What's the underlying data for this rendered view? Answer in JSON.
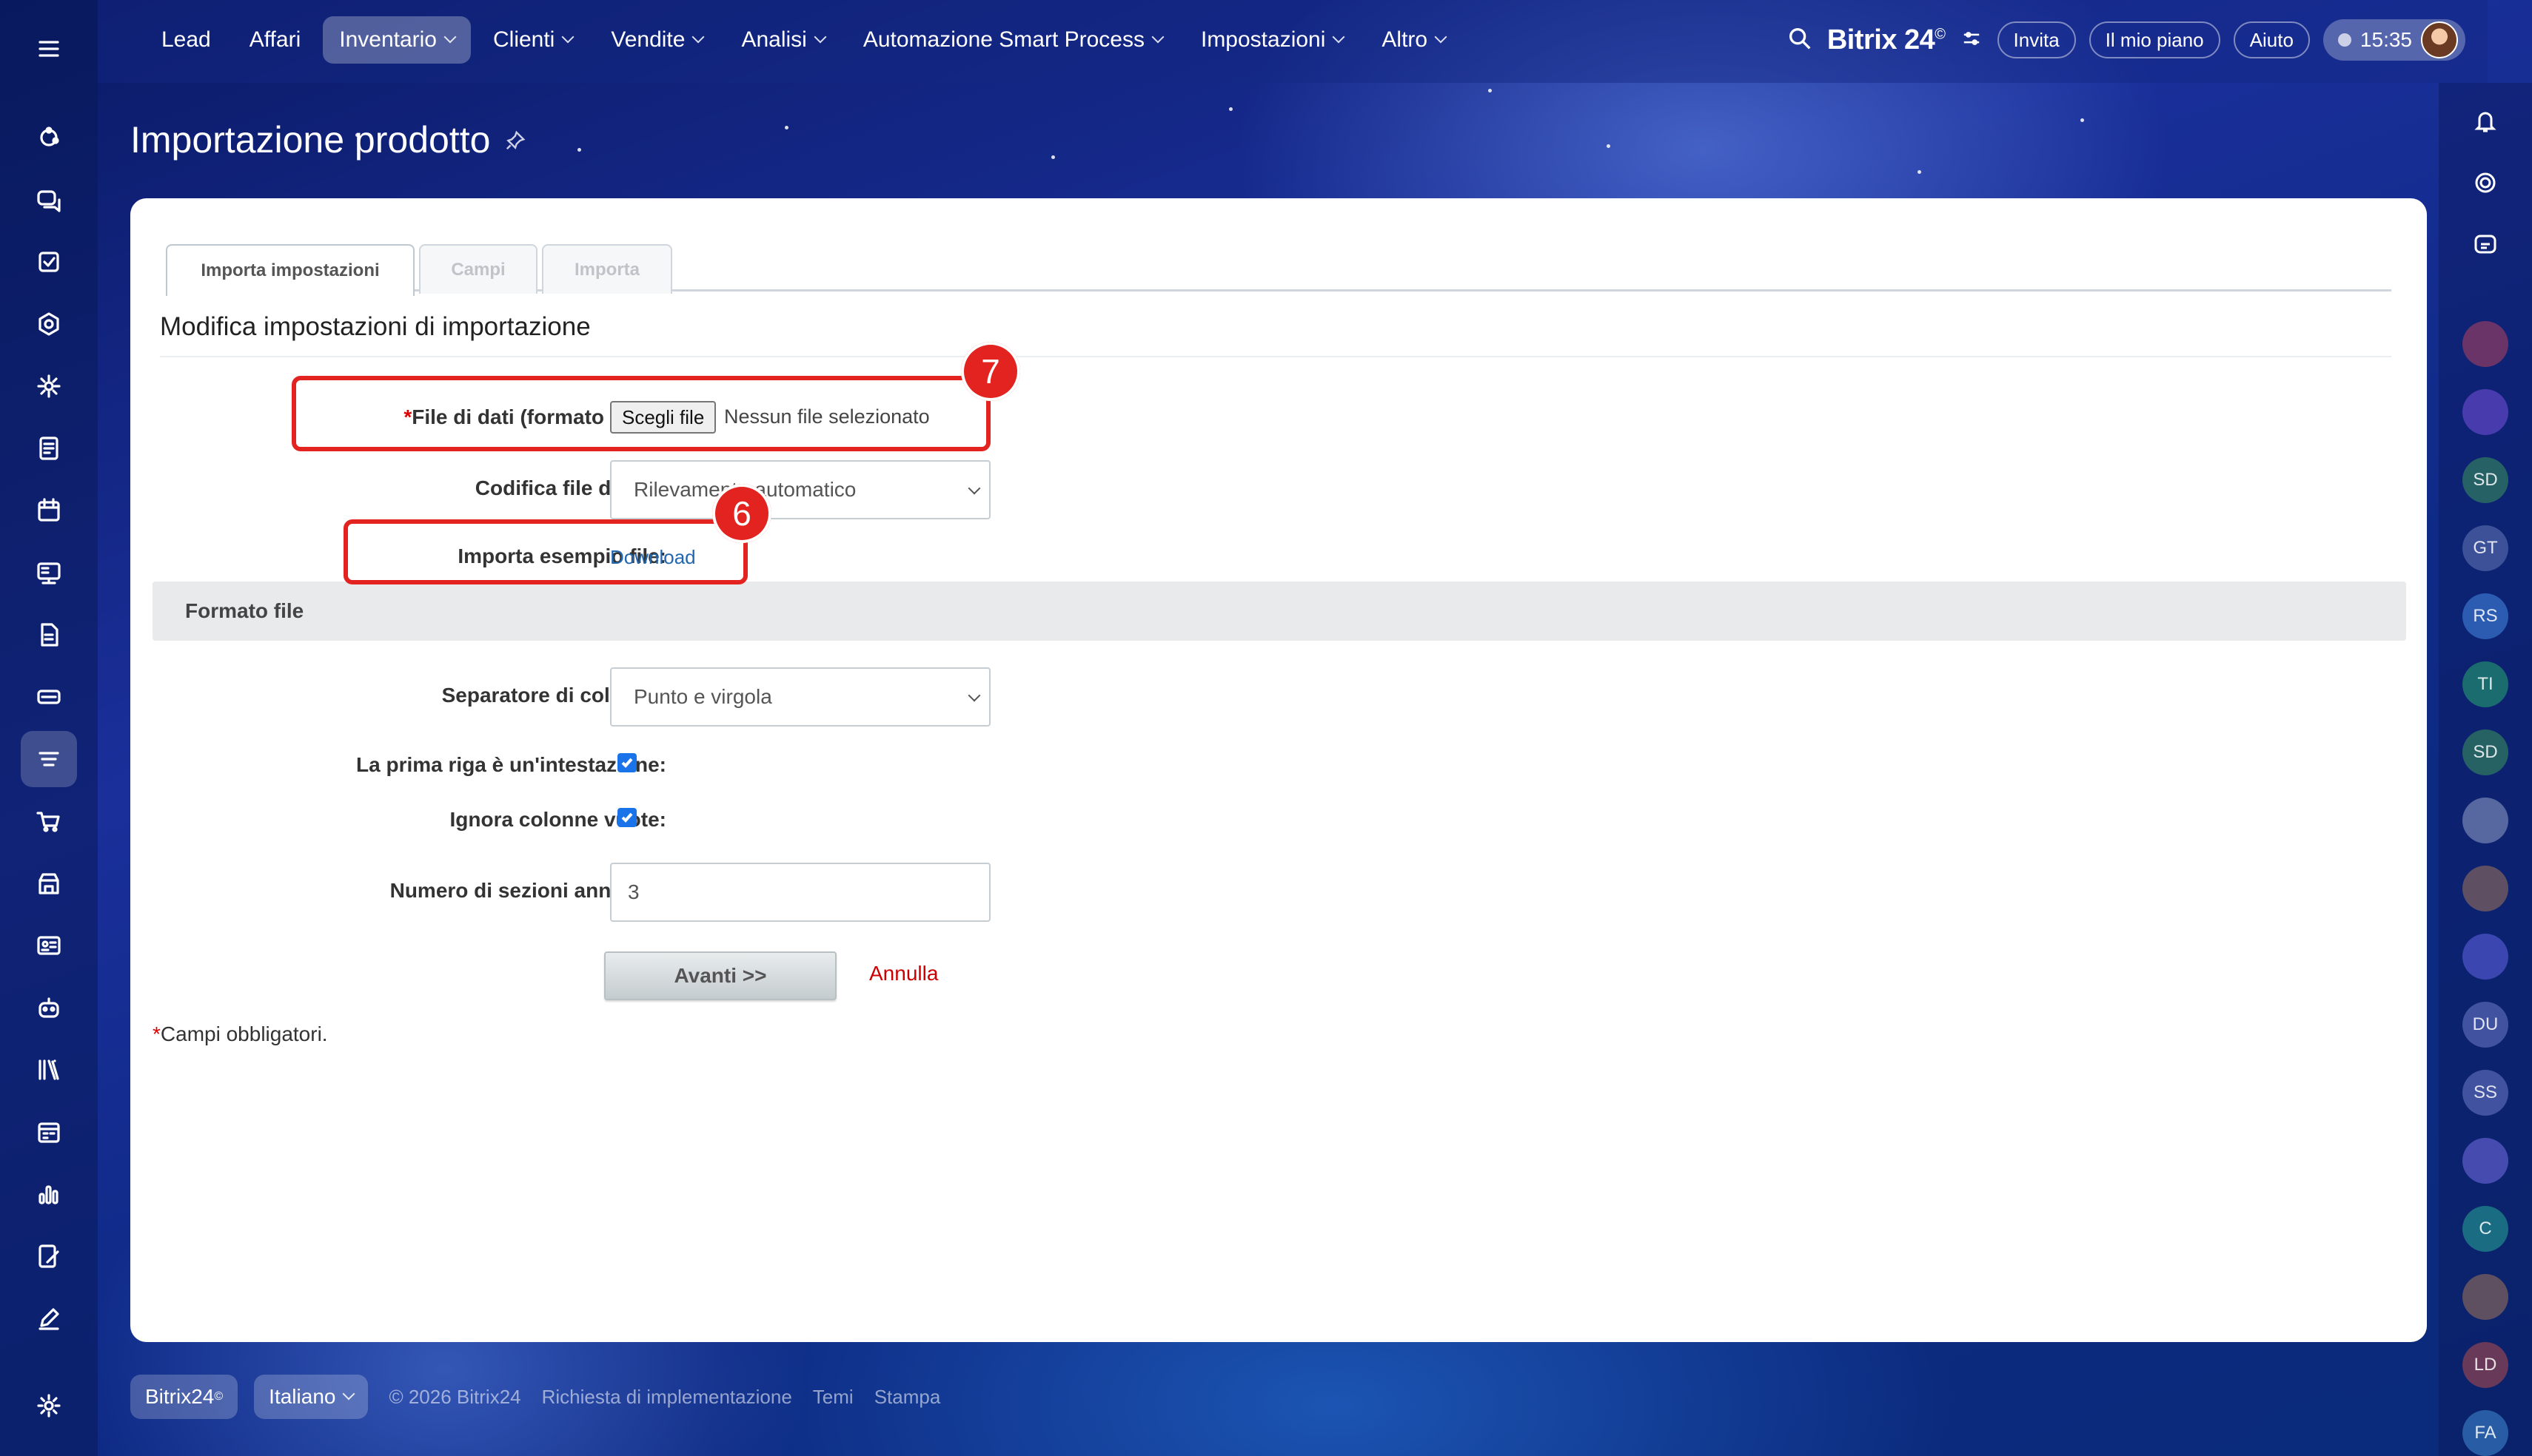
{
  "topbar": {
    "nav": [
      {
        "label": "Lead",
        "dropdown": false,
        "active": false
      },
      {
        "label": "Affari",
        "dropdown": false,
        "active": false
      },
      {
        "label": "Inventario",
        "dropdown": true,
        "active": true
      },
      {
        "label": "Clienti",
        "dropdown": true,
        "active": false
      },
      {
        "label": "Vendite",
        "dropdown": true,
        "active": false
      },
      {
        "label": "Analisi",
        "dropdown": true,
        "active": false
      },
      {
        "label": "Automazione Smart Process",
        "dropdown": true,
        "active": false
      },
      {
        "label": "Impostazioni",
        "dropdown": true,
        "active": false
      },
      {
        "label": "Altro",
        "dropdown": true,
        "active": false
      }
    ],
    "brand": "Bitrix 24",
    "brand_mark": "©",
    "invite_label": "Invita",
    "plan_label": "Il mio piano",
    "help_label": "Aiuto",
    "time": "15:35"
  },
  "page": {
    "title": "Importazione prodotto"
  },
  "tabs": [
    "Importa impostazioni",
    "Campi",
    "Importa"
  ],
  "form": {
    "section_title": "Modifica impostazioni di importazione",
    "file_label": "File di dati (formato CSV):",
    "required_mark": "*",
    "file_button": "Scegli file",
    "file_none": "Nessun file selezionato",
    "encoding_label": "Codifica file di dati:",
    "encoding_value": "Rilevamento automatico",
    "sample_label": "Importa esempio file:",
    "sample_link": "Download",
    "format_section": "Formato file",
    "separator_label": "Separatore di colonne:",
    "separator_value": "Punto e virgola",
    "first_row_label": "La prima riga è un'intestazione:",
    "first_row_checked": true,
    "ignore_empty_label": "Ignora colonne vuote:",
    "ignore_empty_checked": true,
    "nested_label": "Numero di sezioni annidate:",
    "nested_value": "3",
    "next_button": "Avanti >>",
    "cancel_link": "Annulla",
    "required_note": "Campi obbligatori."
  },
  "annotations": {
    "badge_file": "7",
    "badge_sample": "6",
    "color": "#e3231f"
  },
  "rightbar": {
    "initials": [
      "SD",
      "GT",
      "RS",
      "TI",
      "SD",
      "DU",
      "SS",
      "C",
      "LD",
      "FA"
    ]
  },
  "footer": {
    "brand": "Bitrix24",
    "brand_mark": "©",
    "language": "Italiano",
    "copyright": "© 2026 Bitrix24",
    "implementation": "Richiesta di implementazione",
    "themes": "Temi",
    "print": "Stampa"
  }
}
